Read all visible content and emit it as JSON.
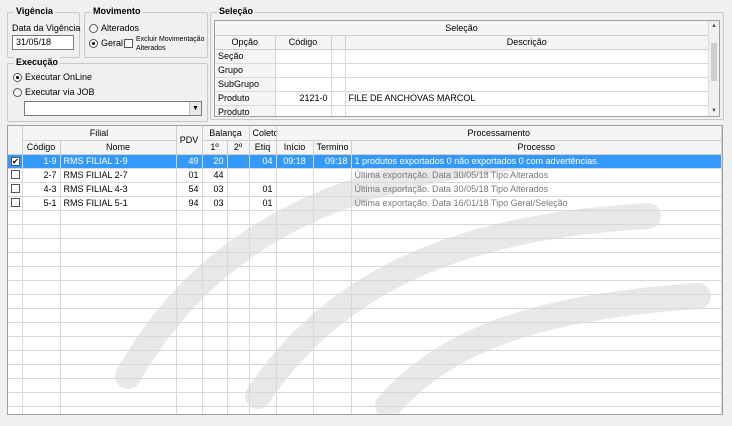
{
  "vigencia": {
    "title": "Vigência",
    "label": "Data da Vigência",
    "value": "31/05/18"
  },
  "movimento": {
    "title": "Movimento",
    "options": [
      "Alterados",
      "Geral"
    ],
    "selected": "Geral",
    "checkbox_label_1": "Excluir Movimentação",
    "checkbox_label_2": "Alterados",
    "checkbox_checked": false
  },
  "execucao": {
    "title": "Execução",
    "options": [
      "Executar OnLine",
      "Executar via JOB"
    ],
    "selected": "Executar OnLine",
    "job_value": ""
  },
  "selecao": {
    "title": "Seleção",
    "grid_title": "Seleção",
    "columns": [
      "Opção",
      "Código",
      "Descrição"
    ],
    "rows": [
      {
        "opcao": "Seção",
        "codigo": "",
        "descricao": ""
      },
      {
        "opcao": "Grupo",
        "codigo": "",
        "descricao": ""
      },
      {
        "opcao": "SubGrupo",
        "codigo": "",
        "descricao": ""
      },
      {
        "opcao": "Produto",
        "codigo": "2121-0",
        "descricao": "FILE DE ANCHOVAS MARCOL"
      },
      {
        "opcao": "Produto",
        "codigo": "",
        "descricao": ""
      }
    ]
  },
  "main_grid": {
    "group_headers": {
      "filial": "Filial",
      "pdv": "PDV",
      "balanca": "Balança",
      "coletor": "Coletor",
      "processamento": "Processamento"
    },
    "sub_headers": {
      "codigo": "Código",
      "nome": "Nome",
      "bal1": "1º",
      "bal2": "2º",
      "etiq": "Etiq",
      "inicio": "Início",
      "termino": "Termino",
      "processo": "Processo"
    },
    "rows": [
      {
        "checked": true,
        "selected": true,
        "codigo": "1-9",
        "nome": "RMS FILIAL 1-9",
        "pdv": "49",
        "bal1": "20",
        "bal2": "",
        "etiq": "04",
        "inicio": "09:18",
        "termino": "09:18",
        "processo": "1 produtos exportados 0 não exportados 0 com advertências.",
        "processo_gray": false
      },
      {
        "checked": false,
        "selected": false,
        "codigo": "2-7",
        "nome": "RMS FILIAL 2-7",
        "pdv": "01",
        "bal1": "44",
        "bal2": "",
        "etiq": "",
        "inicio": "",
        "termino": "",
        "processo": "Última exportação. Data 30/05/18 Tipo Alterados",
        "processo_gray": true
      },
      {
        "checked": false,
        "selected": false,
        "codigo": "4-3",
        "nome": "RMS FILIAL 4-3",
        "pdv": "54",
        "bal1": "03",
        "bal2": "",
        "etiq": "01",
        "inicio": "",
        "termino": "",
        "processo": "Última exportação. Data 30/05/18 Tipo Alterados",
        "processo_gray": true
      },
      {
        "checked": false,
        "selected": false,
        "codigo": "5-1",
        "nome": "RMS FILIAL 5-1",
        "pdv": "94",
        "bal1": "03",
        "bal2": "",
        "etiq": "01",
        "inicio": "",
        "termino": "",
        "processo": "Última exportação. Data 16/01/18 Tipo Geral/Seleção",
        "processo_gray": true
      }
    ],
    "empty_rows": 15
  }
}
